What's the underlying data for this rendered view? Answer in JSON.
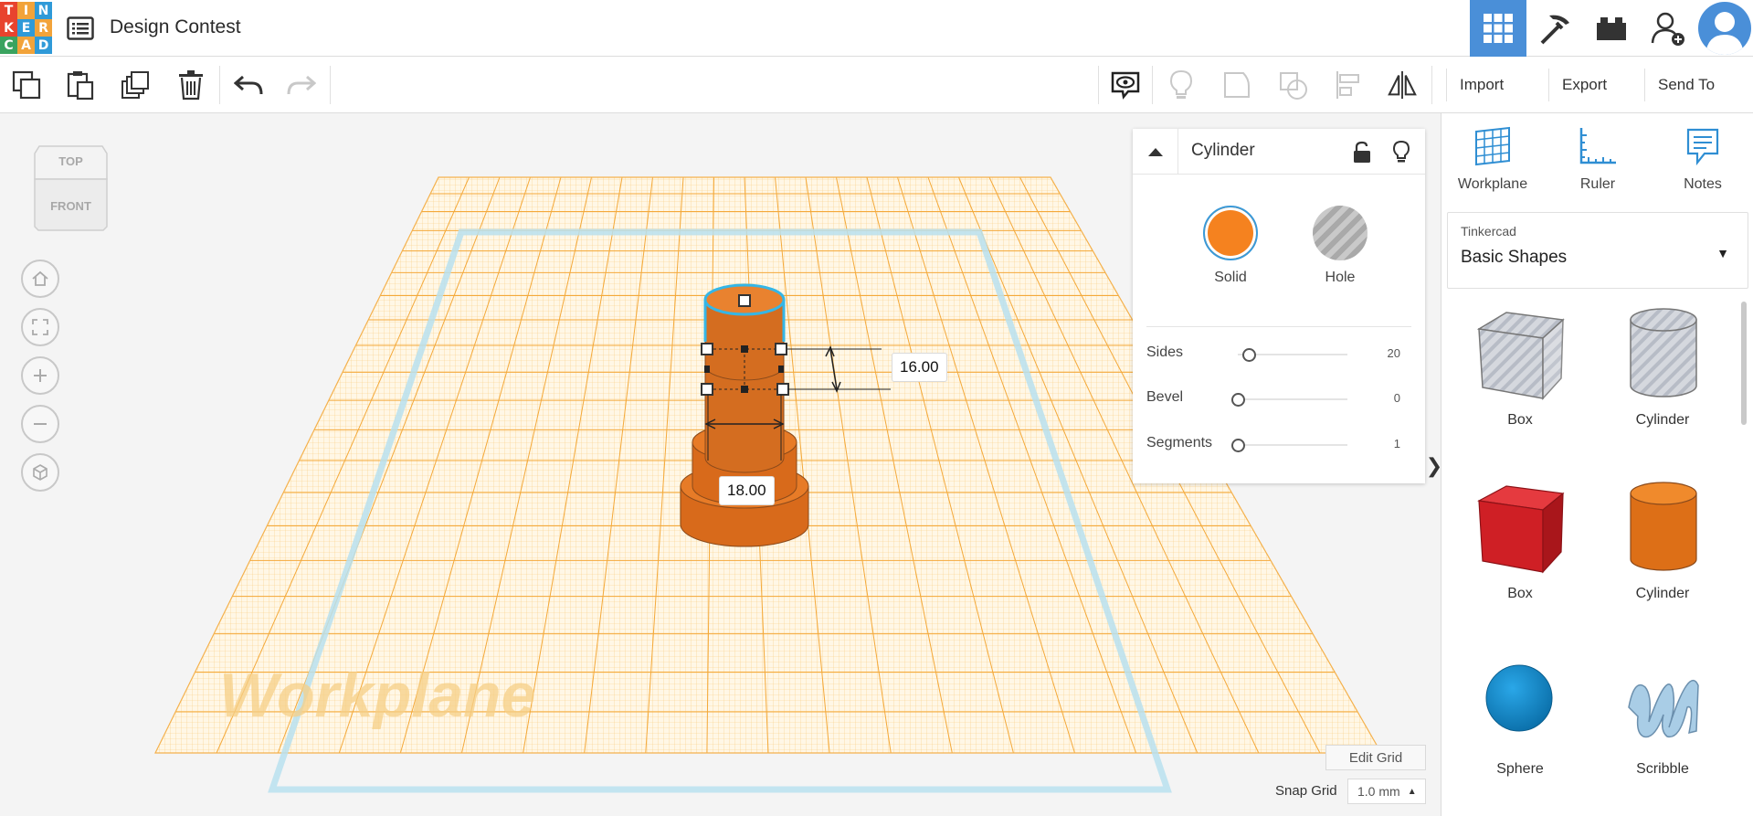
{
  "app": {
    "logo_letters": [
      "T",
      "I",
      "N",
      "K",
      "E",
      "R",
      "C",
      "A",
      "D"
    ],
    "logo_colors": [
      "#e8432e",
      "#f2a33a",
      "#2f9ad8",
      "#e8432e",
      "#2f9ad8",
      "#f2a33a",
      "#3aa35f",
      "#f2a33a",
      "#2f9ad8"
    ],
    "title": "Design Contest"
  },
  "toolbar": {
    "import_label": "Import",
    "export_label": "Export",
    "send_to_label": "Send To"
  },
  "viewcube": {
    "top_label": "TOP",
    "front_label": "FRONT"
  },
  "workplane": {
    "watermark": "Workplane",
    "grid_color": "#f4a93a",
    "border_color": "#b8e0ee"
  },
  "dimensions": {
    "height_value": "16.00",
    "width_value": "18.00"
  },
  "inspector": {
    "shape_title": "Cylinder",
    "solid_label": "Solid",
    "hole_label": "Hole",
    "solid_color": "#f5821f",
    "props": [
      {
        "label": "Sides",
        "value": "20",
        "fraction": 0.1
      },
      {
        "label": "Bevel",
        "value": "0",
        "fraction": 0.0
      },
      {
        "label": "Segments",
        "value": "1",
        "fraction": 0.0
      }
    ]
  },
  "grid_controls": {
    "edit_grid_label": "Edit Grid",
    "snap_label": "Snap Grid",
    "snap_value": "1.0 mm"
  },
  "panel": {
    "tools": [
      {
        "label": "Workplane",
        "icon": "workplane-icon"
      },
      {
        "label": "Ruler",
        "icon": "ruler-icon"
      },
      {
        "label": "Notes",
        "icon": "notes-icon"
      }
    ],
    "library_source": "Tinkercad",
    "library_name": "Basic Shapes",
    "shapes": [
      {
        "name": "Box",
        "kind": "box-hole"
      },
      {
        "name": "Cylinder",
        "kind": "cylinder-hole"
      },
      {
        "name": "Box",
        "kind": "box-solid",
        "color": "#d6222a"
      },
      {
        "name": "Cylinder",
        "kind": "cylinder-solid",
        "color": "#e3731a"
      },
      {
        "name": "Sphere",
        "kind": "sphere",
        "color": "#1a8fd0"
      },
      {
        "name": "Scribble",
        "kind": "scribble",
        "color": "#a9cde6"
      }
    ]
  }
}
